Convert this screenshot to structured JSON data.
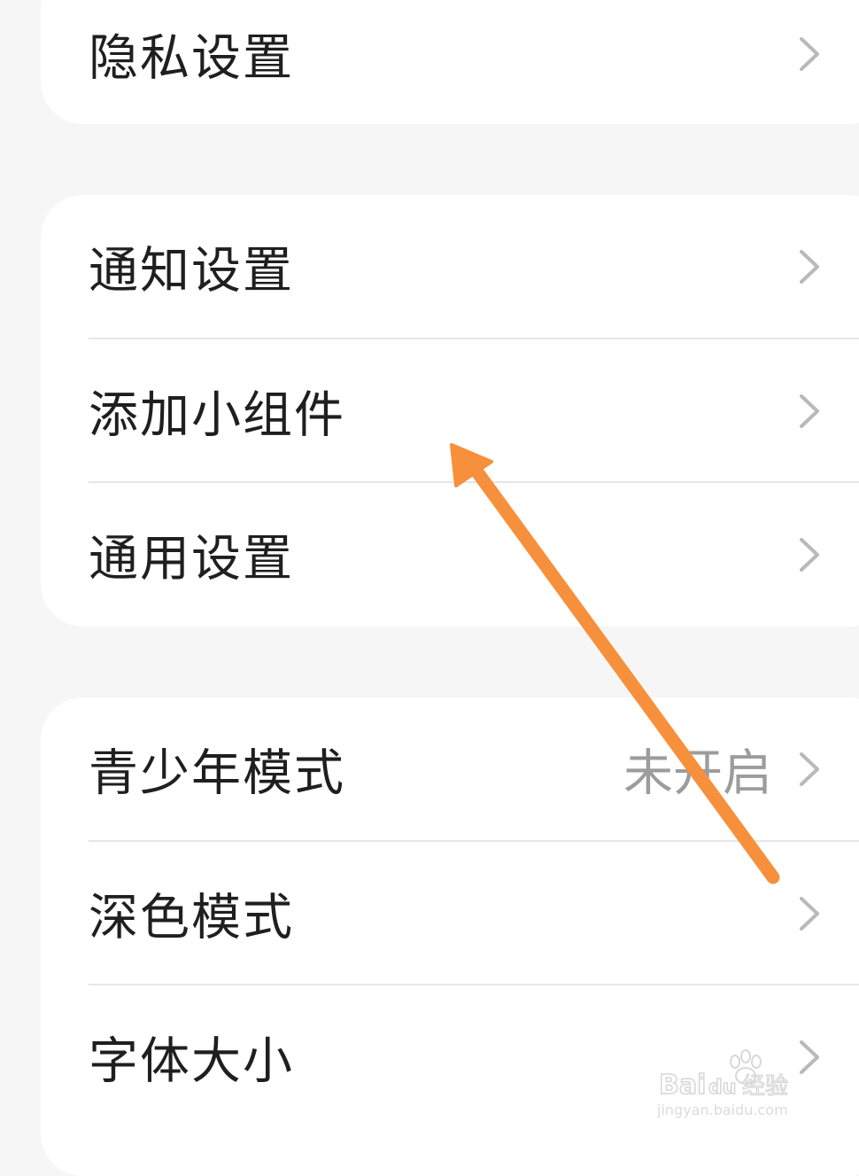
{
  "settings": {
    "privacy": "隐私设置",
    "notify": "通知设置",
    "widget": "添加小组件",
    "general": "通用设置",
    "teen": "青少年模式",
    "teen_value": "未开启",
    "dark": "深色模式",
    "font": "字体大小"
  },
  "icons": {
    "chevron": "chevron-right-icon",
    "annotation": "orange-arrow-annotation"
  },
  "colors": {
    "annotation_arrow": "#f7903c",
    "background": "#f6f6f6",
    "card": "#ffffff"
  },
  "watermark": {
    "brand": "Baidu经验",
    "url": "jingyan.baidu.com"
  }
}
